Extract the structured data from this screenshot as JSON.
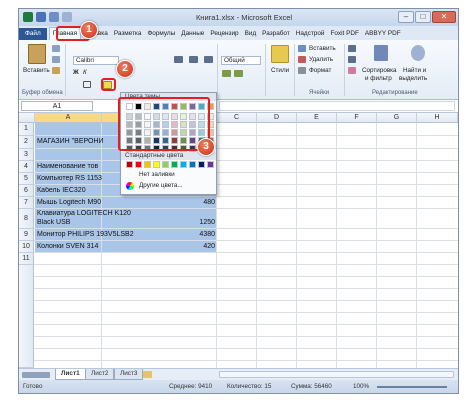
{
  "window": {
    "title": "Книга1.xlsx - Microsoft Excel",
    "btn_min": "–",
    "btn_max": "□",
    "btn_close": "✕"
  },
  "tabs": [
    "Файл",
    "Главная",
    "Вставка",
    "Разметка",
    "Формулы",
    "Данные",
    "Рецензир",
    "Вид",
    "Разработ",
    "Надстрой",
    "Foxit PDF",
    "ABBYY PDF"
  ],
  "ribbon": {
    "paste": "Вставить",
    "clipboard_group": "Буфер обмена",
    "font_name": "Calibri",
    "number_format": "Общий",
    "styles": "Стили",
    "insert": "Вставить",
    "delete": "Удалить",
    "format": "Формат",
    "cells_group": "Ячейки",
    "sort_filter_1": "Сортировка",
    "sort_filter_2": "и фильтр",
    "find_select_1": "Найти и",
    "find_select_2": "выделить",
    "editing_group": "Редактирование"
  },
  "formula_bar": {
    "name_box": "A1"
  },
  "columns": [
    "A",
    "B",
    "C",
    "D",
    "E",
    "F",
    "G",
    "H"
  ],
  "rows": [
    "1",
    "2",
    "3",
    "4",
    "5",
    "6",
    "7",
    "8",
    "9",
    "10",
    "11"
  ],
  "cells": {
    "a2": "МАГАЗИН \"ВЕРОНИ",
    "a4": "Наименование тов",
    "a5": "Компьютер RS 1153",
    "a6": "Кабель IEC320",
    "a7": "Мышь Logitech M90",
    "b7": "480",
    "a8_1": "Клавиатура LOGITECH K120",
    "a8_2": "Black USB",
    "b8": "1250",
    "a9": "Монитор PHILIPS 193V5LSB2",
    "b9": "4380",
    "a10": "Колонки SVEN 314",
    "b10": "420"
  },
  "palette": {
    "theme_title": "Цвета темы",
    "standard_title": "Стандартные цвета",
    "no_fill": "Нет заливки",
    "more_colors": "Другие цвета...",
    "theme_top": [
      "#ffffff",
      "#000000",
      "#eeece1",
      "#1f497d",
      "#4f81bd",
      "#c0504d",
      "#9bbb59",
      "#8064a2",
      "#4bacc6",
      "#f79646"
    ],
    "standard": [
      "#c00000",
      "#ff0000",
      "#ffc000",
      "#ffff00",
      "#92d050",
      "#00b050",
      "#00b0f0",
      "#0070c0",
      "#002060",
      "#7030a0"
    ]
  },
  "badges": [
    "1",
    "2",
    "3"
  ],
  "sheets": [
    "Лист1",
    "Лист2",
    "Лист3"
  ],
  "status": {
    "ready": "Готово",
    "avg": "Среднее: 9410",
    "count": "Количество: 15",
    "sum": "Сумма: 56460",
    "zoom": "100%"
  }
}
